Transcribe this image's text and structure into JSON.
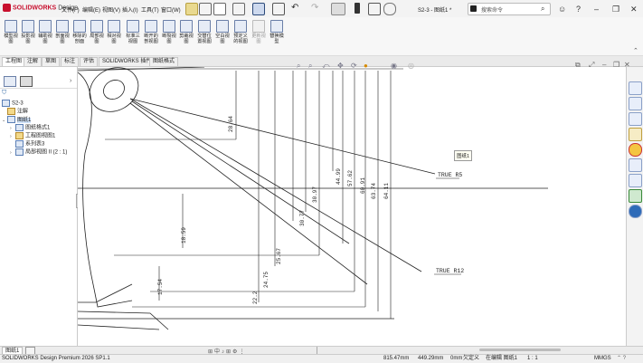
{
  "app": {
    "logo_brand": "SOLIDWORKS",
    "logo_suffix": "Design"
  },
  "menu": [
    "文件(F)",
    "编辑(E)",
    "视图(V)",
    "插入(I)",
    "工具(T)",
    "窗口(W)"
  ],
  "doc_title": "S2-3 - 图纸1 *",
  "search": {
    "placeholder": "搜索命令"
  },
  "commands": [
    {
      "label": "模型视图"
    },
    {
      "label": "投影视图"
    },
    {
      "label": "辅助视图"
    },
    {
      "label": "剖面视图"
    },
    {
      "label": "移除的剖面"
    },
    {
      "label": "局部视图"
    },
    {
      "label": "相对视图"
    },
    {
      "label": "标准三视图"
    },
    {
      "label": "断开的剖视图"
    },
    {
      "label": "断裂视图"
    },
    {
      "label": "剪裁视图"
    },
    {
      "label": "交替位置视图"
    },
    {
      "label": "空白视图"
    },
    {
      "label": "预定义的视图"
    },
    {
      "label": "更新视图"
    },
    {
      "label": "替换模型"
    }
  ],
  "tabs": [
    "工程图",
    "注解",
    "草图",
    "标注",
    "评估",
    "SOLIDWORKS 插件",
    "图纸格式"
  ],
  "tree": {
    "root": "S2-3",
    "items": [
      {
        "label": "注解",
        "level": 1
      },
      {
        "label": "图纸1",
        "level": 1
      },
      {
        "label": "图纸格式1",
        "level": 2
      },
      {
        "label": "工程图视图1",
        "level": 2
      },
      {
        "label": "系列表3",
        "level": 2
      },
      {
        "label": "局部视图 II (2 : 1)",
        "level": 2
      }
    ]
  },
  "drawing": {
    "dims_vertical": [
      "28.64",
      "44.99",
      "57.62",
      "60.91",
      "63.74",
      "64.11",
      "30.97",
      "30.77",
      "18.59",
      "25.67",
      "24.75",
      "17.54",
      "22.2"
    ],
    "notes": [
      "TRUE R5",
      "TRUE R12"
    ],
    "tooltip": "图纸1"
  },
  "sheet_tab": "图纸1",
  "status": {
    "product": "SOLIDWORKS Design Premium 2026 SP1.1",
    "x": "815.47mm",
    "y": "449.29mm",
    "z": "0mm",
    "mode": "欠定义",
    "editing": "在编辑 图纸1",
    "scale": "1 : 1",
    "units": "MMGS"
  }
}
